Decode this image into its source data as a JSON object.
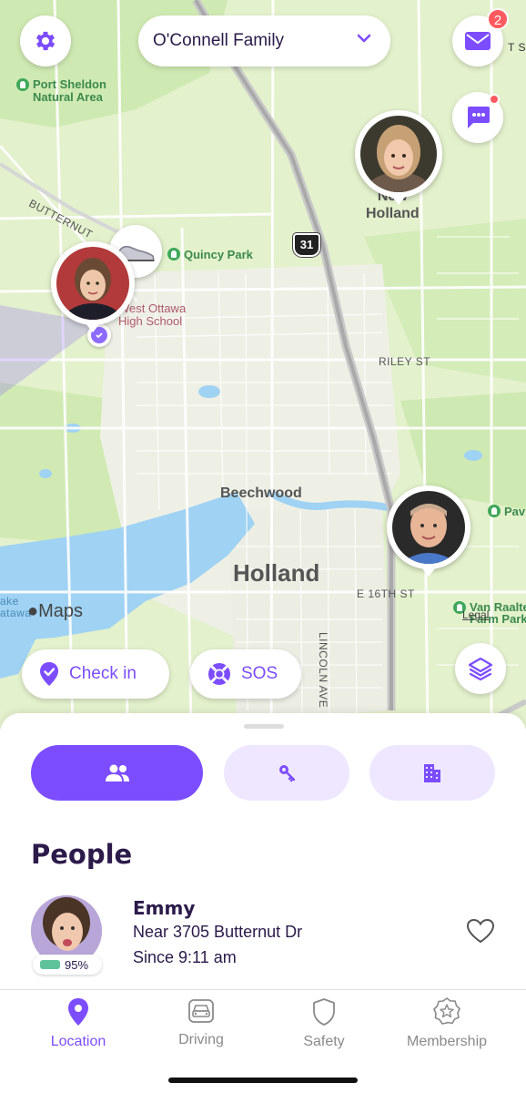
{
  "header": {
    "circle_name": "O'Connell Family",
    "inbox_badge": "2",
    "icons": {
      "settings": "gear-icon",
      "circle_dropdown": "chevron-down-icon",
      "inbox": "envelope-icon",
      "chat": "chat-bubble-icon",
      "layers": "layers-icon"
    }
  },
  "map": {
    "labels": {
      "port_sheldon": "Port Sheldon\nNatural Area",
      "butternut": "BUTTERNUT",
      "quincy_park": "Quincy Park",
      "west_ottawa": "West Ottawa\nHigh School",
      "new_holland": "New\nHolland",
      "riley_st": "RILEY ST",
      "beechwood": "Beechwood",
      "holland": "Holland",
      "e16th": "E 16TH ST",
      "lincoln_ave": "LINCOLN AVE",
      "van_raalte": "Van Raalte\nFarm Park",
      "legal": "Legal",
      "pav": "Pav",
      "lake": "ake\natawa",
      "route": "31",
      "edge_st": "T SH"
    },
    "attribution": "Maps"
  },
  "actions": {
    "check_in": "Check in",
    "sos": "SOS"
  },
  "sheet": {
    "tabs": [
      {
        "name": "people",
        "icon": "people-icon"
      },
      {
        "name": "items",
        "icon": "tile-tracker-icon"
      },
      {
        "name": "places",
        "icon": "building-icon"
      }
    ],
    "section_title": "People",
    "member": {
      "name": "Emmy",
      "location": "Near 3705 Butternut Dr",
      "since": "Since 9:11 am",
      "battery": "95%"
    }
  },
  "tabbar": {
    "items": [
      {
        "label": "Location",
        "icon": "location-pin-icon",
        "active": true
      },
      {
        "label": "Driving",
        "icon": "car-icon",
        "active": false
      },
      {
        "label": "Safety",
        "icon": "shield-icon",
        "active": false
      },
      {
        "label": "Membership",
        "icon": "star-badge-icon",
        "active": false
      }
    ]
  },
  "colors": {
    "accent": "#7c4dff",
    "accent_light": "#efe7ff",
    "text_dark": "#2b1a4a",
    "badge_red": "#ff5a5f",
    "battery_green": "#5ec39a",
    "map_green": "#dff0c4"
  }
}
